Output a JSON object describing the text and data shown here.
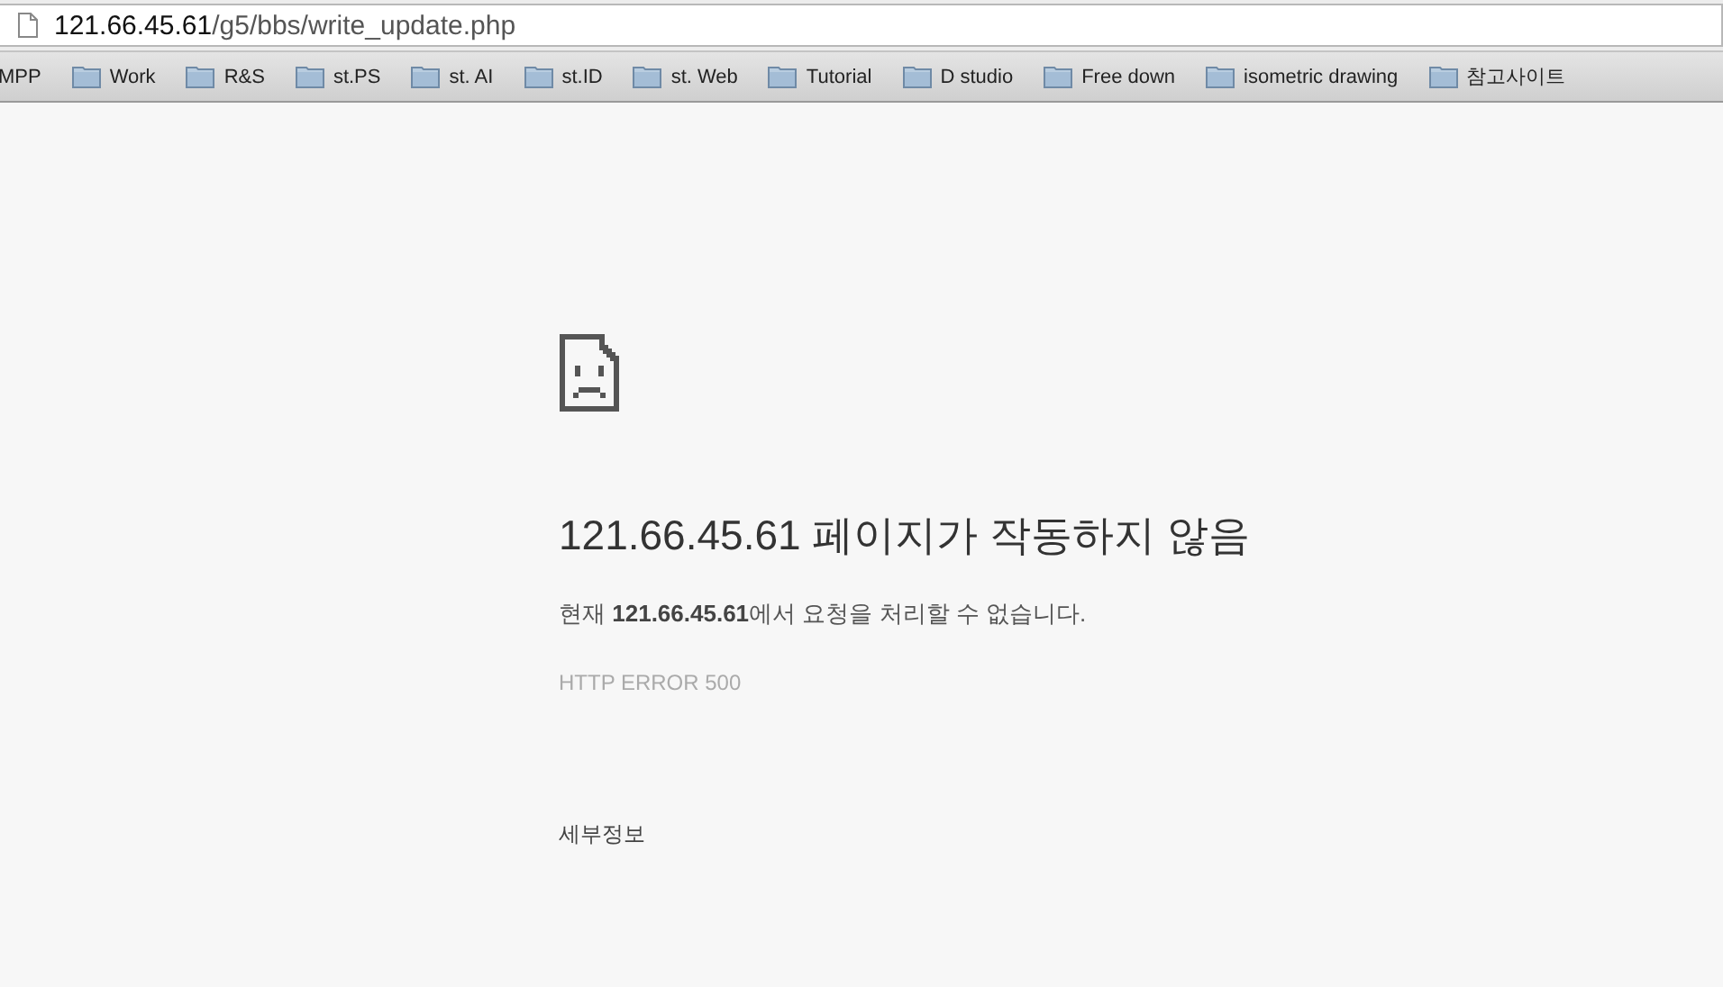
{
  "address_bar": {
    "host": "121.66.45.61",
    "path": "/g5/bbs/write_update.php"
  },
  "bookmarks": [
    {
      "label": "MPP",
      "kind": "link"
    },
    {
      "label": "Work",
      "kind": "folder"
    },
    {
      "label": "R&S",
      "kind": "folder"
    },
    {
      "label": "st.PS",
      "kind": "folder"
    },
    {
      "label": "st. AI",
      "kind": "folder"
    },
    {
      "label": "st.ID",
      "kind": "folder"
    },
    {
      "label": "st. Web",
      "kind": "folder"
    },
    {
      "label": "Tutorial",
      "kind": "folder"
    },
    {
      "label": "D studio",
      "kind": "folder"
    },
    {
      "label": "Free down",
      "kind": "folder"
    },
    {
      "label": "isometric drawing",
      "kind": "folder"
    },
    {
      "label": "참고사이트",
      "kind": "folder"
    }
  ],
  "error_page": {
    "heading": "121.66.45.61 페이지가 작동하지 않음",
    "message": "현재 **121.66.45.61**에서 요청을 처리할 수 없습니다.",
    "error_code": "HTTP ERROR 500",
    "details_link": "세부정보"
  }
}
